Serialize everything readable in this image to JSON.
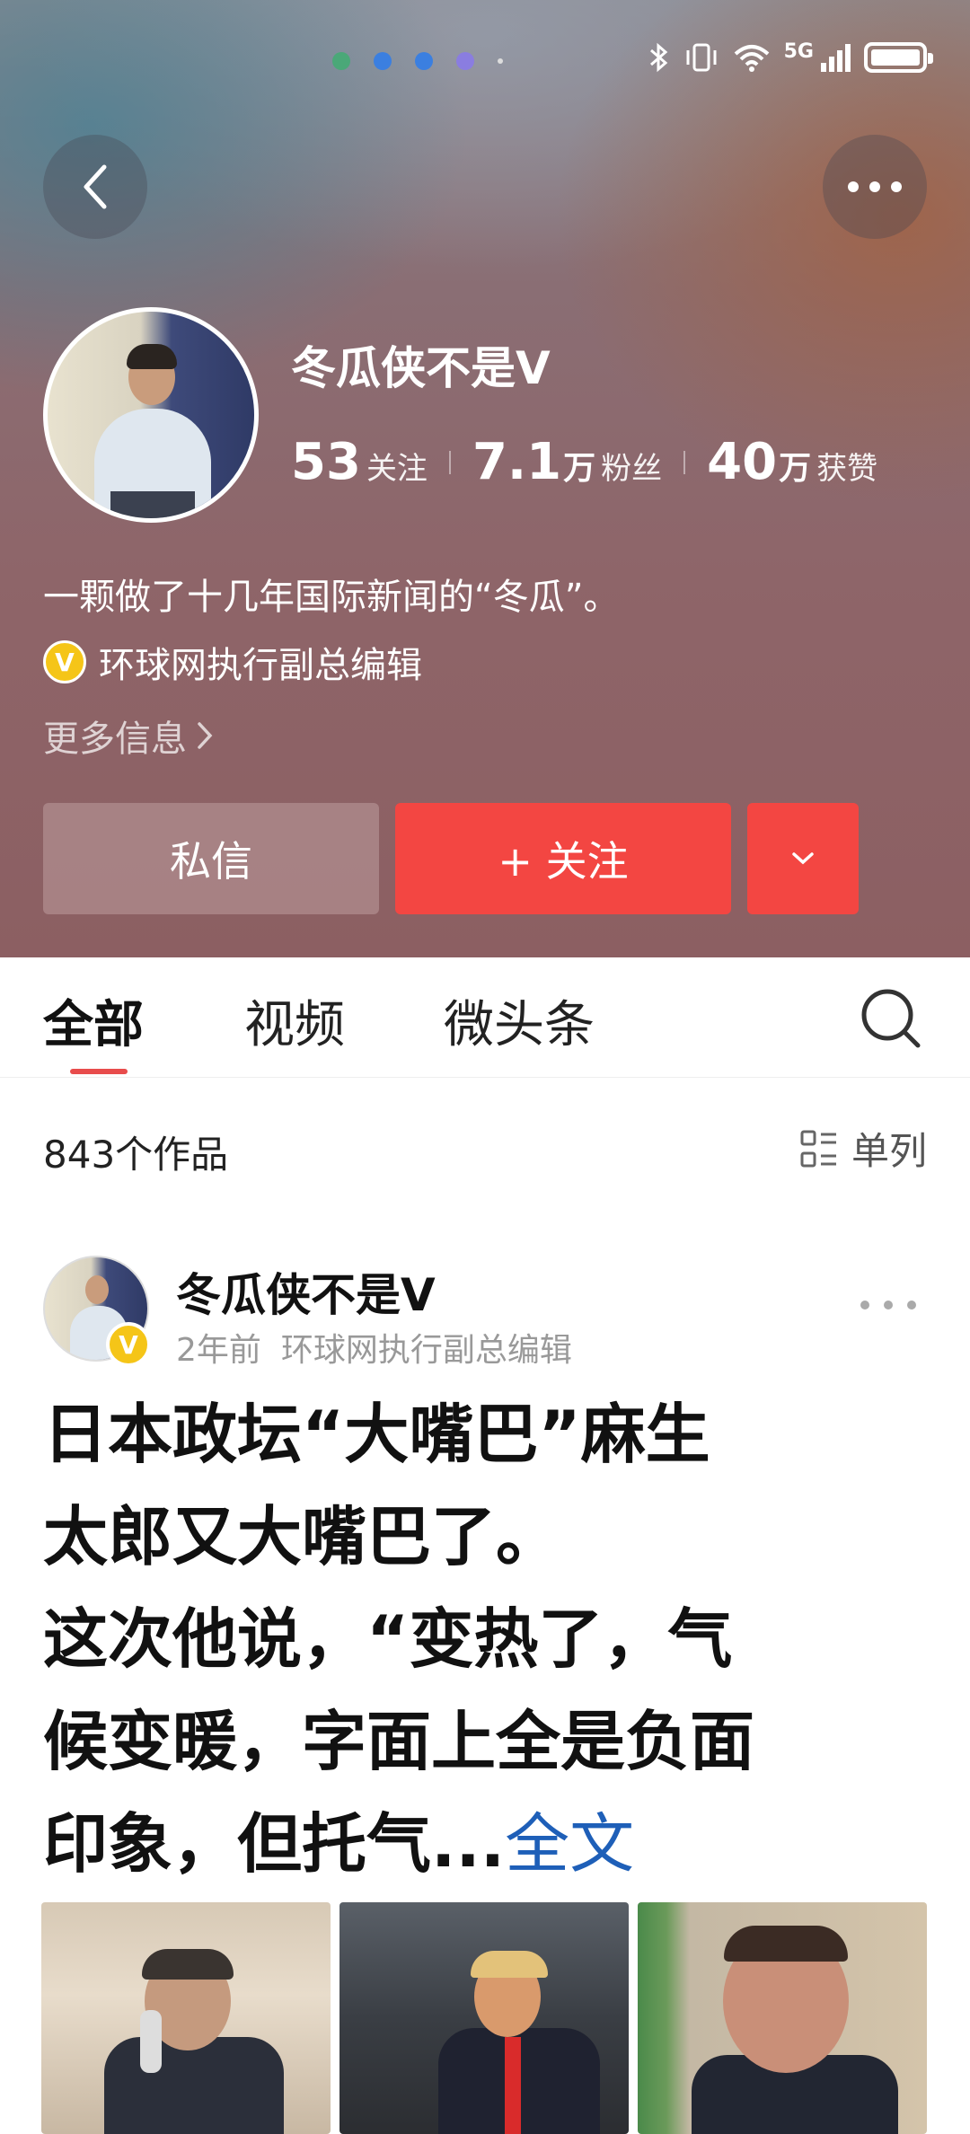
{
  "status_bar": {
    "dots": [
      "#4aa878",
      "#3b7fe0",
      "#3b7fe0",
      "#8a7de0"
    ],
    "network": "5G",
    "icons": [
      "bluetooth-icon",
      "vibrate-icon",
      "wifi-icon",
      "signal-icon",
      "battery-icon"
    ]
  },
  "header": {
    "back_icon": "chevron-left-icon",
    "more_icon": "more-dots-icon",
    "name": "冬瓜侠不是V",
    "stats": {
      "following_num": "53",
      "following_label": "关注",
      "followers_num": "7.1",
      "followers_unit": "万",
      "followers_label": "粉丝",
      "likes_num": "40",
      "likes_unit": "万",
      "likes_label": "获赞"
    },
    "bio": "一颗做了十几年国际新闻的“冬瓜”。",
    "verification": "环球网执行副总编辑",
    "more_info": "更多信息",
    "buttons": {
      "message": "私信",
      "follow": "+ 关注",
      "dropdown_icon": "chevron-down-icon"
    }
  },
  "tabs": {
    "items": [
      "全部",
      "视频",
      "微头条"
    ],
    "active": 0,
    "search_icon": "search-icon"
  },
  "works": {
    "count": "843个作品",
    "layout_label": "单列"
  },
  "post": {
    "author": "冬瓜侠不是V",
    "time": "2年前",
    "author_title": "环球网执行副总编辑",
    "lines": [
      "日本政坛“大嘴巴”麻生",
      "太郎又大嘴巴了。",
      "这次他说，“变热了，气",
      "候变暖，字面上全是负面",
      "印象，但托气..."
    ],
    "full_text_link": "全文"
  },
  "colors": {
    "accent_red": "#f34642",
    "link_blue": "#1e5fb8",
    "verify_gold": "#f5c518"
  }
}
